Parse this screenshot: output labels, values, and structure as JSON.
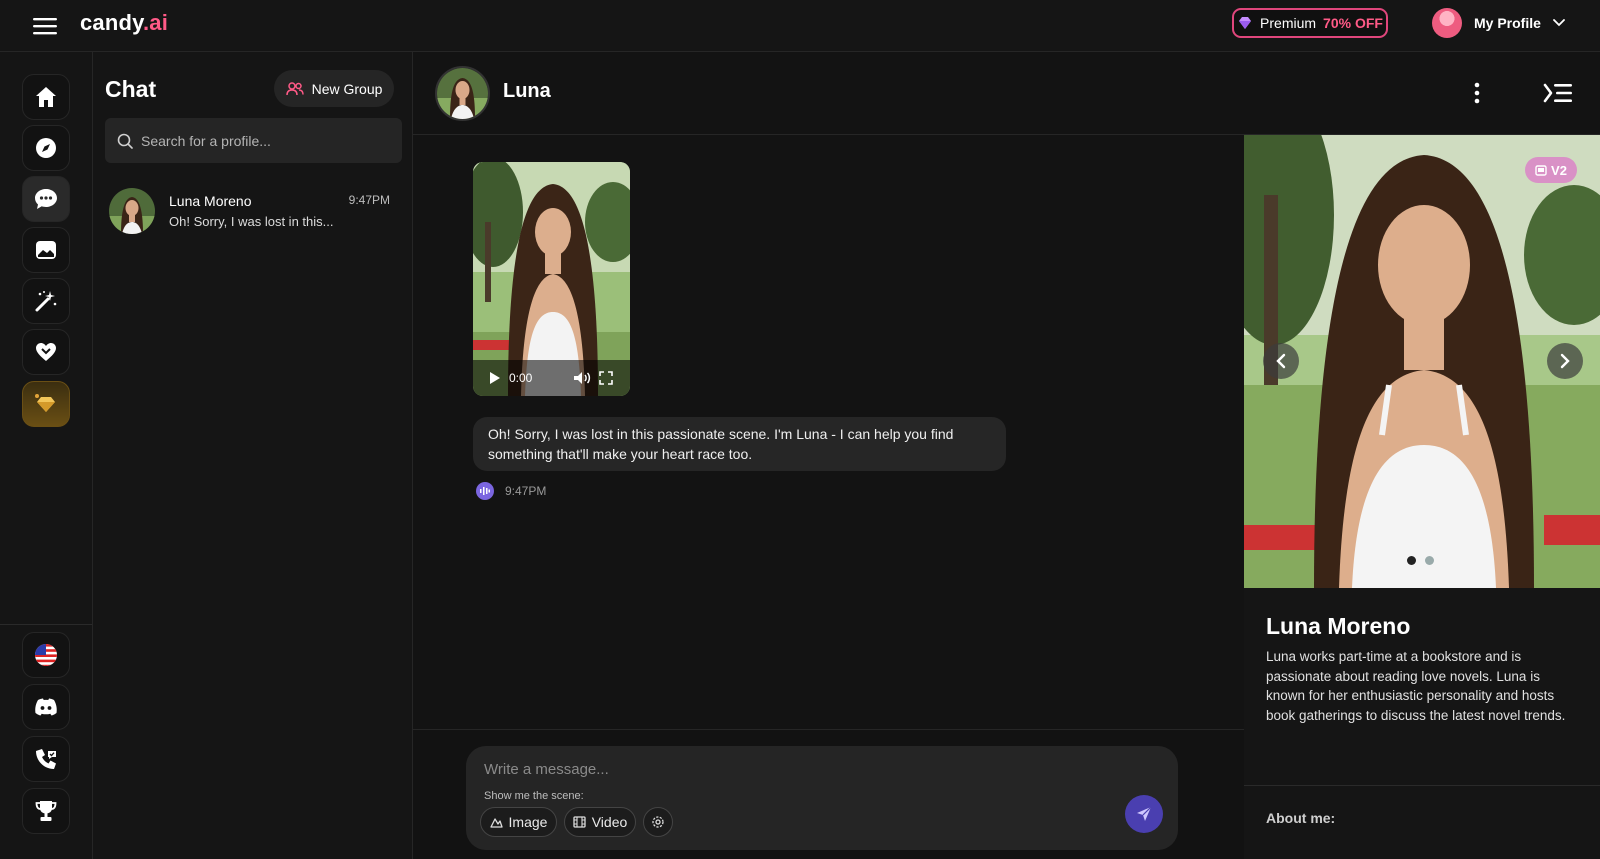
{
  "app": {
    "logo_main": "candy",
    "logo_accent": ".ai",
    "premium_label": "Premium",
    "premium_discount": "70% OFF",
    "profile_label": "My Profile"
  },
  "chat_list": {
    "title": "Chat",
    "new_group_label": "New Group",
    "search_placeholder": "Search for a profile...",
    "conversations": [
      {
        "name": "Luna Moreno",
        "time": "9:47PM",
        "preview": "Oh! Sorry, I was lost in this..."
      }
    ]
  },
  "chat": {
    "header_name": "Luna",
    "video": {
      "time": "0:00"
    },
    "message_text": "Oh! Sorry, I was lost in this passionate scene. I'm Luna - I can help you find something that'll make your heart race too.",
    "message_time": "9:47PM",
    "composer": {
      "placeholder": "Write a message...",
      "scene_label": "Show me the scene:",
      "image_label": "Image",
      "video_label": "Video"
    }
  },
  "profile_panel": {
    "badge": "V2",
    "name": "Luna Moreno",
    "description": "Luna works part-time at a bookstore and is passionate about reading love novels. Luna is known for her enthusiastic personality and hosts book gatherings to discuss the latest novel trends.",
    "about_label": "About me:",
    "carousel_index": 1,
    "carousel_count": 2
  },
  "colors": {
    "accent_pink": "#ff5a87",
    "send_purple": "#4a3fb0",
    "voice_purple": "#7b66e0",
    "gold": "#6a4f14"
  }
}
